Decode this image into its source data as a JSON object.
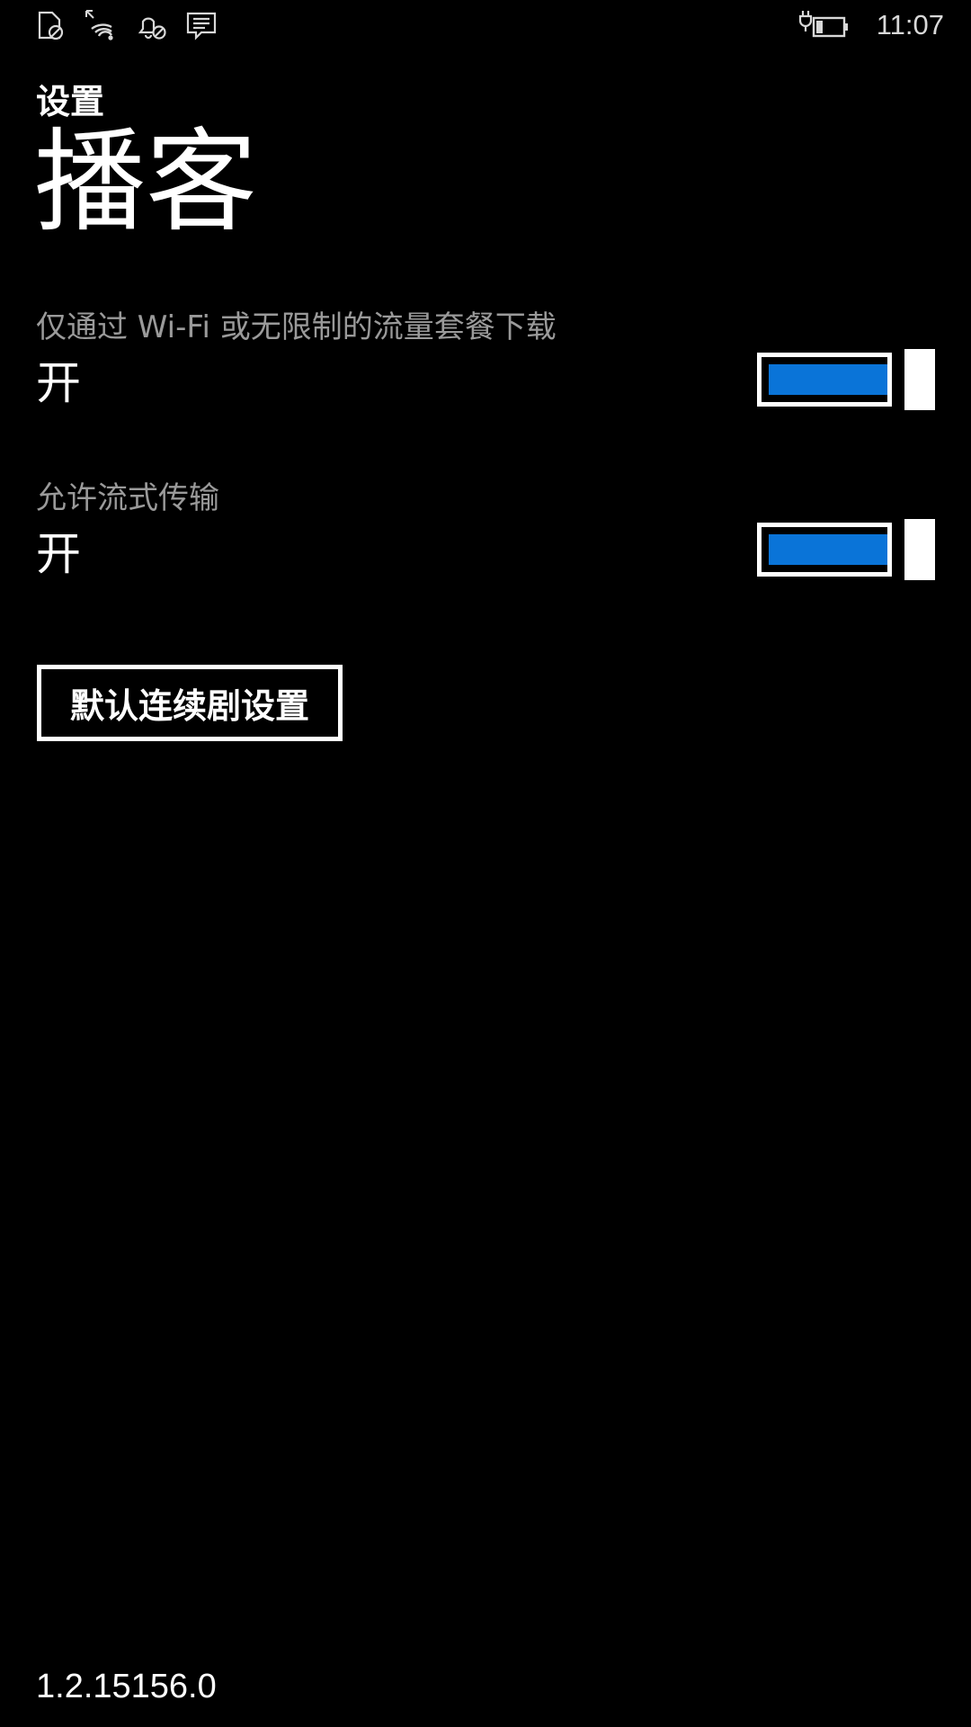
{
  "status_bar": {
    "icons": [
      "no-sim-icon",
      "wifi-icon",
      "quiet-hours-icon",
      "message-icon",
      "battery-charging-icon"
    ],
    "time": "11:07"
  },
  "header": {
    "subtitle": "设置",
    "title": "播客"
  },
  "settings": [
    {
      "label": "仅通过 Wi-Fi 或无限制的流量套餐下载",
      "state_text": "开",
      "enabled": true
    },
    {
      "label": "允许流式传输",
      "state_text": "开",
      "enabled": true
    }
  ],
  "button": {
    "label": "默认连续剧设置"
  },
  "version": "1.2.15156.0",
  "colors": {
    "background": "#000000",
    "accent": "#0a74d8",
    "label_gray": "#9a9a9a",
    "text": "#ffffff"
  }
}
